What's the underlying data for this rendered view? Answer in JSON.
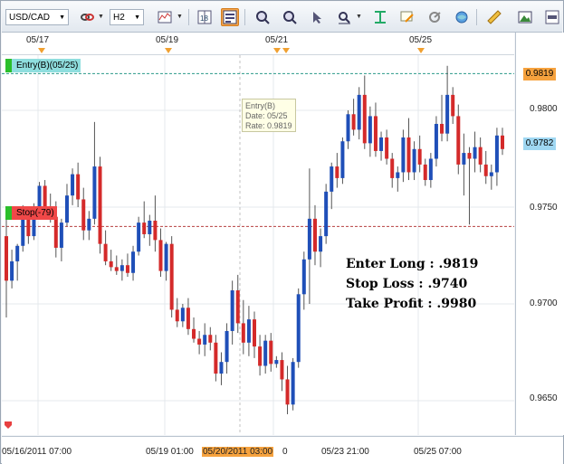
{
  "toolbar": {
    "symbol": "USD/CAD",
    "timeframe": "H2",
    "buttons": [
      {
        "name": "link-icon"
      },
      {
        "name": "indicator-icon"
      },
      {
        "name": "chart-type-icon"
      },
      {
        "name": "layout-icon"
      },
      {
        "name": "grid-icon"
      },
      {
        "name": "zoom-in-icon"
      },
      {
        "name": "zoom-out-icon"
      },
      {
        "name": "cursor-icon"
      },
      {
        "name": "crosshair-icon"
      },
      {
        "name": "fit-icon"
      },
      {
        "name": "annotation-icon"
      },
      {
        "name": "refresh-icon"
      },
      {
        "name": "globe-icon"
      },
      {
        "name": "ruler-icon"
      },
      {
        "name": "image-icon"
      }
    ]
  },
  "datebar": {
    "labels": [
      "05/17",
      "05/19",
      "05/21",
      "05/25"
    ]
  },
  "y_axis": {
    "ticks": [
      "0.9800",
      "0.9750",
      "0.9700",
      "0.9650"
    ]
  },
  "x_axis": {
    "labels": [
      "05/16/2011 07:00",
      "05/19 01:00",
      "05/20/2011 03:00",
      "0",
      "05/23 21:00",
      "05/25 07:00"
    ]
  },
  "entry_price": "0.9819",
  "current_price": "0.9782",
  "entry_tag": "Entry(B)(05/25)",
  "stop_tag": "Stop(-79)",
  "tooltip": {
    "line1": "Entry(B)",
    "line2": "Date: 05/25",
    "line3": "Rate: 0.9819"
  },
  "annotations": {
    "enter": "Enter Long : .9819",
    "stop": "Stop Loss : .9740",
    "take": "Take Profit : .9980"
  },
  "colors": {
    "up": "#1f4fb8",
    "down": "#d42a2a",
    "entry_line": "#2a9a8a",
    "stop_line": "#b84040",
    "entry_tag_bg": "#8fdede",
    "stop_tag_bg": "#f04848",
    "price_highlight": "#f6a23e",
    "current_bg": "#9fd7f2"
  },
  "candles": [
    [
      0.9735,
      0.9745,
      0.9693,
      0.9712
    ],
    [
      0.9712,
      0.9728,
      0.9708,
      0.9722
    ],
    [
      0.9722,
      0.9731,
      0.9712,
      0.973
    ],
    [
      0.973,
      0.9751,
      0.9727,
      0.9746
    ],
    [
      0.9746,
      0.975,
      0.9731,
      0.9735
    ],
    [
      0.9735,
      0.9752,
      0.9733,
      0.9749
    ],
    [
      0.9749,
      0.9763,
      0.9744,
      0.9761
    ],
    [
      0.9761,
      0.9764,
      0.9744,
      0.9749
    ],
    [
      0.9749,
      0.9757,
      0.9742,
      0.9745
    ],
    [
      0.9745,
      0.9753,
      0.9724,
      0.9729
    ],
    [
      0.9729,
      0.9744,
      0.9722,
      0.9742
    ],
    [
      0.9742,
      0.9762,
      0.974,
      0.9756
    ],
    [
      0.9756,
      0.977,
      0.9751,
      0.9767
    ],
    [
      0.9767,
      0.9773,
      0.975,
      0.9754
    ],
    [
      0.9754,
      0.976,
      0.9733,
      0.9738
    ],
    [
      0.9738,
      0.9748,
      0.9733,
      0.9744
    ],
    [
      0.9744,
      0.9794,
      0.9741,
      0.9771
    ],
    [
      0.9771,
      0.9776,
      0.9726,
      0.9731
    ],
    [
      0.9731,
      0.9738,
      0.972,
      0.9722
    ],
    [
      0.9722,
      0.9728,
      0.9717,
      0.9719
    ],
    [
      0.9719,
      0.9725,
      0.9715,
      0.9717
    ],
    [
      0.9717,
      0.9723,
      0.9712,
      0.972
    ],
    [
      0.972,
      0.9726,
      0.9714,
      0.9716
    ],
    [
      0.9716,
      0.973,
      0.9712,
      0.9727
    ],
    [
      0.9727,
      0.9745,
      0.9725,
      0.9742
    ],
    [
      0.9742,
      0.9753,
      0.9734,
      0.9736
    ],
    [
      0.9736,
      0.9746,
      0.973,
      0.9743
    ],
    [
      0.9743,
      0.9756,
      0.9727,
      0.9733
    ],
    [
      0.9733,
      0.9739,
      0.9714,
      0.9717
    ],
    [
      0.9717,
      0.9732,
      0.9712,
      0.9731
    ],
    [
      0.9731,
      0.9735,
      0.9693,
      0.9697
    ],
    [
      0.9697,
      0.9703,
      0.9688,
      0.9691
    ],
    [
      0.9691,
      0.97,
      0.9688,
      0.9698
    ],
    [
      0.9698,
      0.9703,
      0.9684,
      0.9687
    ],
    [
      0.9687,
      0.9693,
      0.968,
      0.9682
    ],
    [
      0.9682,
      0.9686,
      0.9674,
      0.9679
    ],
    [
      0.9679,
      0.969,
      0.9673,
      0.9684
    ],
    [
      0.9684,
      0.9688,
      0.9676,
      0.968
    ],
    [
      0.968,
      0.9684,
      0.966,
      0.9664
    ],
    [
      0.9664,
      0.9675,
      0.9658,
      0.967
    ],
    [
      0.967,
      0.969,
      0.9664,
      0.9686
    ],
    [
      0.9686,
      0.9712,
      0.9679,
      0.9707
    ],
    [
      0.9707,
      0.9715,
      0.9685,
      0.969
    ],
    [
      0.969,
      0.9702,
      0.9674,
      0.968
    ],
    [
      0.968,
      0.9699,
      0.9673,
      0.9692
    ],
    [
      0.9692,
      0.9696,
      0.9672,
      0.9678
    ],
    [
      0.9678,
      0.9684,
      0.9663,
      0.9668
    ],
    [
      0.9668,
      0.9684,
      0.9664,
      0.9681
    ],
    [
      0.9681,
      0.9685,
      0.9665,
      0.9669
    ],
    [
      0.9669,
      0.9673,
      0.9667,
      0.9671
    ],
    [
      0.9671,
      0.9675,
      0.9655,
      0.9661
    ],
    [
      0.9661,
      0.9668,
      0.9643,
      0.9648
    ],
    [
      0.9648,
      0.9672,
      0.9645,
      0.967
    ],
    [
      0.967,
      0.9708,
      0.9667,
      0.9705
    ],
    [
      0.9705,
      0.9727,
      0.9697,
      0.9723
    ],
    [
      0.9723,
      0.977,
      0.97,
      0.9744
    ],
    [
      0.9744,
      0.9751,
      0.972,
      0.9727
    ],
    [
      0.9727,
      0.9739,
      0.9719,
      0.9735
    ],
    [
      0.9735,
      0.9762,
      0.9731,
      0.9758
    ],
    [
      0.9758,
      0.9773,
      0.9749,
      0.9771
    ],
    [
      0.9771,
      0.9778,
      0.976,
      0.9765
    ],
    [
      0.9765,
      0.9786,
      0.9762,
      0.9784
    ],
    [
      0.9784,
      0.98,
      0.978,
      0.9798
    ],
    [
      0.9798,
      0.9806,
      0.9787,
      0.979
    ],
    [
      0.979,
      0.9812,
      0.9785,
      0.9808
    ],
    [
      0.9808,
      0.9818,
      0.978,
      0.9783
    ],
    [
      0.9783,
      0.9802,
      0.9776,
      0.9797
    ],
    [
      0.9797,
      0.9804,
      0.9776,
      0.9779
    ],
    [
      0.9779,
      0.9789,
      0.9774,
      0.9786
    ],
    [
      0.9786,
      0.979,
      0.9772,
      0.9775
    ],
    [
      0.9775,
      0.9778,
      0.976,
      0.9765
    ],
    [
      0.9765,
      0.9771,
      0.9758,
      0.9768
    ],
    [
      0.9768,
      0.979,
      0.9763,
      0.9786
    ],
    [
      0.9786,
      0.9796,
      0.9764,
      0.9768
    ],
    [
      0.9768,
      0.9784,
      0.9764,
      0.978
    ],
    [
      0.978,
      0.9787,
      0.9768,
      0.9772
    ],
    [
      0.9772,
      0.9775,
      0.9761,
      0.9764
    ],
    [
      0.9764,
      0.9778,
      0.976,
      0.9775
    ],
    [
      0.9775,
      0.9797,
      0.9771,
      0.9793
    ],
    [
      0.9793,
      0.9808,
      0.9784,
      0.9788
    ],
    [
      0.9788,
      0.9823,
      0.9784,
      0.9808
    ],
    [
      0.9808,
      0.9812,
      0.9793,
      0.9797
    ],
    [
      0.9797,
      0.9803,
      0.9767,
      0.9772
    ],
    [
      0.9772,
      0.9788,
      0.9756,
      0.9778
    ],
    [
      0.9778,
      0.9781,
      0.9741,
      0.9775
    ],
    [
      0.9775,
      0.9789,
      0.9768,
      0.9781
    ],
    [
      0.9781,
      0.9786,
      0.9768,
      0.9772
    ],
    [
      0.9772,
      0.9779,
      0.9762,
      0.9766
    ],
    [
      0.9766,
      0.9772,
      0.9759,
      0.9768
    ],
    [
      0.9768,
      0.9791,
      0.9761,
      0.9787
    ],
    [
      0.9787,
      0.9791,
      0.9777,
      0.978
    ]
  ]
}
